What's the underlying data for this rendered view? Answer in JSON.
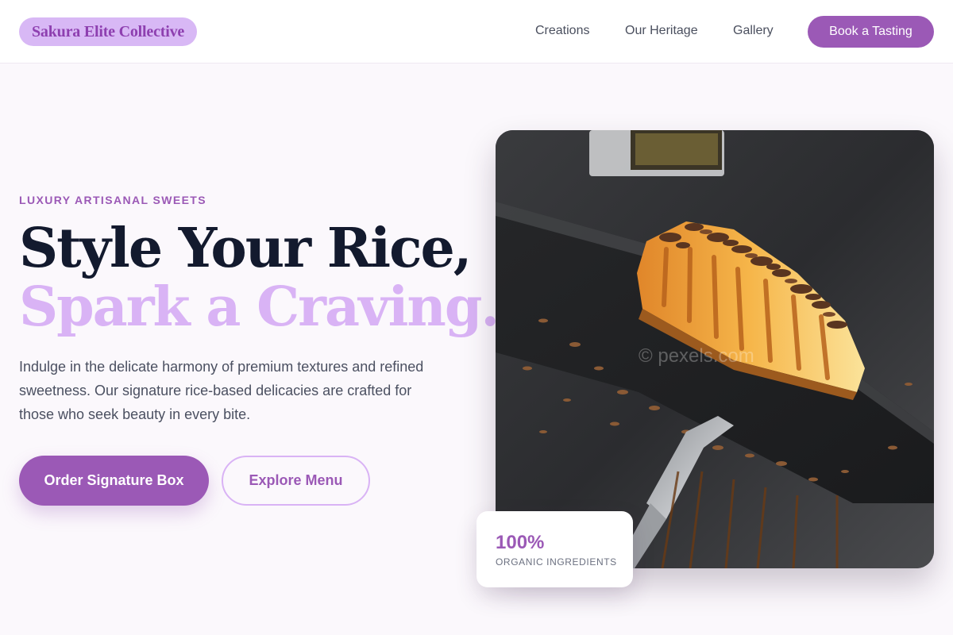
{
  "brand": {
    "logo_text": "Sakura Elite Collective"
  },
  "nav": {
    "items": [
      {
        "label": "Creations"
      },
      {
        "label": "Our Heritage"
      },
      {
        "label": "Gallery"
      }
    ],
    "cta_label": "Book a Tasting"
  },
  "hero": {
    "eyebrow": "LUXURY ARTISANAL SWEETS",
    "title_line1": "Style Your Rice,",
    "title_line2": "Spark a Craving.",
    "description": "Indulge in the delicate harmony of premium textures and refined sweetness. Our signature rice-based delicacies are crafted for those who seek beauty in every bite.",
    "primary_button": "Order Signature Box",
    "secondary_button": "Explore Menu"
  },
  "image": {
    "icon": "cheesecake-slice-photo",
    "watermark": "© pexels.com"
  },
  "stat": {
    "value": "100%",
    "label": "ORGANIC INGREDIENTS"
  },
  "colors": {
    "accent": "#9b59b6",
    "accent_light": "#d9b3f5",
    "logo_bg": "#d8b8f5",
    "heading_dark": "#131a2e",
    "background": "#fbf8fc"
  }
}
